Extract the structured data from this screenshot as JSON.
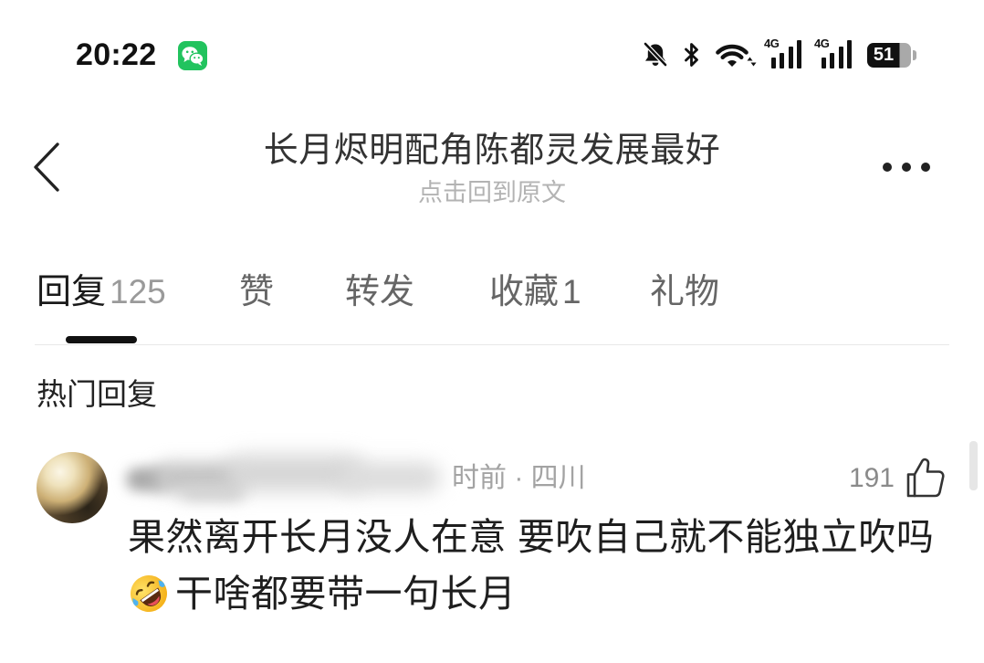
{
  "status_bar": {
    "time": "20:22",
    "network_type_1": "4G",
    "network_type_2": "4G",
    "battery_level": "51",
    "icons": [
      "wechat-icon",
      "mute-bell-icon",
      "bluetooth-icon",
      "wifi-icon",
      "cellular-signal-icon",
      "cellular-signal-icon",
      "battery-icon"
    ]
  },
  "header": {
    "back_icon": "chevron-left-icon",
    "title": "长月烬明配角陈都灵发展最好",
    "subtitle": "点击回到原文",
    "more_icon": "more-horizontal-icon"
  },
  "tabs": [
    {
      "label": "回复",
      "count": "125",
      "active": true
    },
    {
      "label": "赞",
      "active": false
    },
    {
      "label": "转发",
      "active": false
    },
    {
      "label": "收藏",
      "count": "1",
      "active": false
    },
    {
      "label": "礼物",
      "active": false
    }
  ],
  "section_title": "热门回复",
  "comments": [
    {
      "avatar_icon": "user-avatar-photo",
      "username_blurred": true,
      "meta": "时前 · 四川",
      "likes": "191",
      "like_icon": "thumbs-up-icon",
      "text_lines": [
        {
          "text": "果然离开长月没人在意 要吹自己就不能独立吹吗"
        },
        {
          "emoji": "rolling-on-floor-laughing-emoji",
          "text": "干啥都要带一句长月"
        }
      ]
    }
  ],
  "colors": {
    "background": "#ffffff",
    "text_primary": "#222222",
    "text_secondary": "#999999",
    "tab_inactive": "#666666",
    "tab_indicator": "#111111",
    "divider": "#e8e8e8",
    "wechat_green": "#22c35e"
  }
}
